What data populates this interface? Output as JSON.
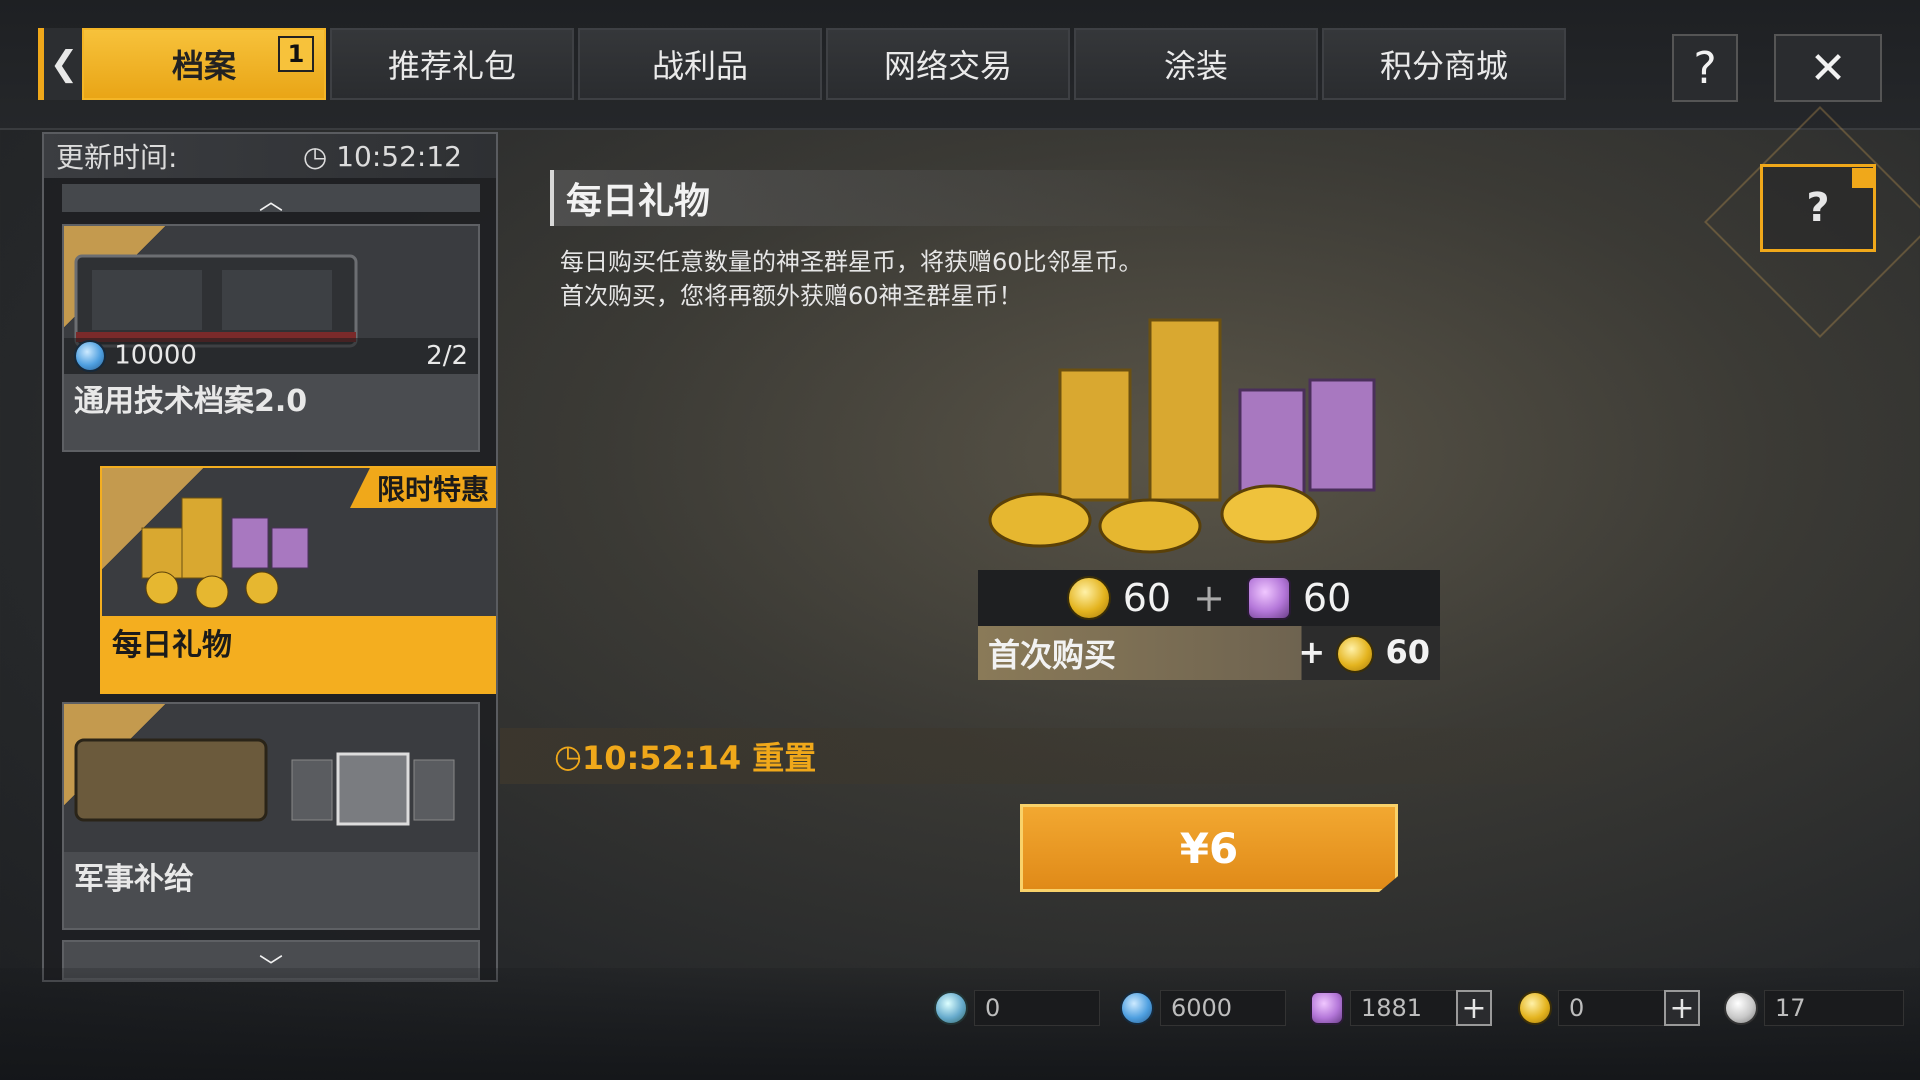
{
  "tabs": [
    {
      "label": "档案",
      "badge": "1",
      "active": true
    },
    {
      "label": "推荐礼包"
    },
    {
      "label": "战利品"
    },
    {
      "label": "网络交易"
    },
    {
      "label": "涂装"
    },
    {
      "label": "积分商城"
    }
  ],
  "help_label": "?",
  "close_label": "✕",
  "back_label": "❮",
  "left_panel": {
    "update_label": "更新时间:",
    "update_time": "10:52:12",
    "items": [
      {
        "title": "通用技术档案2.0",
        "price": "10000",
        "count": "2/2"
      },
      {
        "title": "每日礼物",
        "tag": "限时特惠"
      },
      {
        "title": "军事补给"
      }
    ]
  },
  "main": {
    "title": "每日礼物",
    "desc_line1": "每日购买任意数量的神圣群星币，将获赠60比邻星币。",
    "desc_line2": "首次购买，您将再额外获赠60神圣群星币！",
    "reward_gold": "60",
    "reward_plus": "+",
    "reward_purple": "60",
    "first_buy_label": "首次购买",
    "first_buy_plus": "+",
    "first_buy_value": "60",
    "reset_text": "10:52:14 重置",
    "buy_label": "¥6"
  },
  "currencies": [
    {
      "icon": "teal-gear-icon",
      "value": "0"
    },
    {
      "icon": "blue-cycle-icon",
      "value": "6000"
    },
    {
      "icon": "purple-p-icon",
      "value": "1881"
    },
    {
      "icon": "gold-v-icon",
      "value": "0"
    },
    {
      "icon": "silver-g-icon",
      "value": "17"
    }
  ],
  "colors": {
    "accent": "#f0a81a",
    "gold": "#e4b41f",
    "purple": "#b477d9"
  }
}
